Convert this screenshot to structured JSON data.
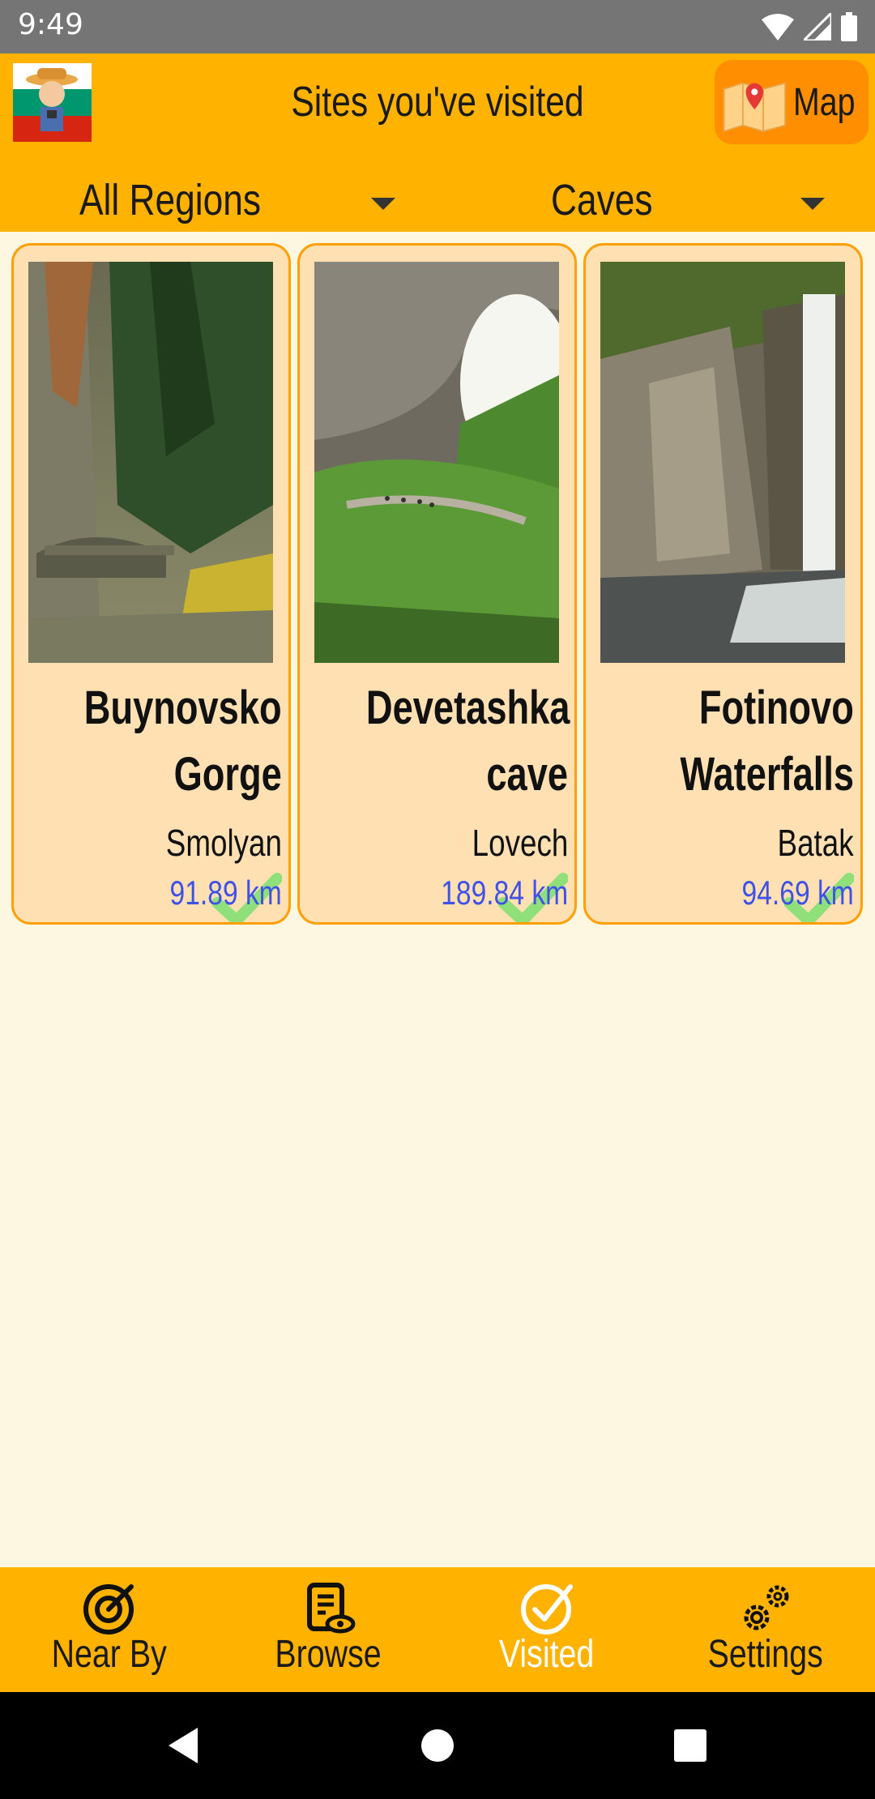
{
  "status_bar": {
    "time": "9:49"
  },
  "header": {
    "title": "Sites you've visited",
    "map_button_label": "Map",
    "region_dropdown": "All Regions",
    "category_dropdown": "Caves"
  },
  "sites": [
    {
      "name_line1": "Buynovsko",
      "name_line2": "Gorge",
      "region": "Smolyan",
      "distance": "91.89 km",
      "visited": true
    },
    {
      "name_line1": "Devetashka",
      "name_line2": "cave",
      "region": "Lovech",
      "distance": "189.84 km",
      "visited": true
    },
    {
      "name_line1": "Fotinovo",
      "name_line2": "Waterfalls",
      "region": "Batak",
      "distance": "94.69 km",
      "visited": true
    }
  ],
  "bottom_nav": [
    {
      "label": "Near By",
      "icon": "target-icon"
    },
    {
      "label": "Browse",
      "icon": "document-eye-icon"
    },
    {
      "label": "Visited",
      "icon": "check-circle-icon",
      "active": true
    },
    {
      "label": "Settings",
      "icon": "gears-icon"
    }
  ],
  "colors": {
    "header": "#ffb300",
    "map_button": "#ff8f00",
    "card_bg": "#ffe0b2",
    "card_border": "#ffa000",
    "distance": "#3f51e6",
    "page_bg": "#fdf6e1"
  }
}
